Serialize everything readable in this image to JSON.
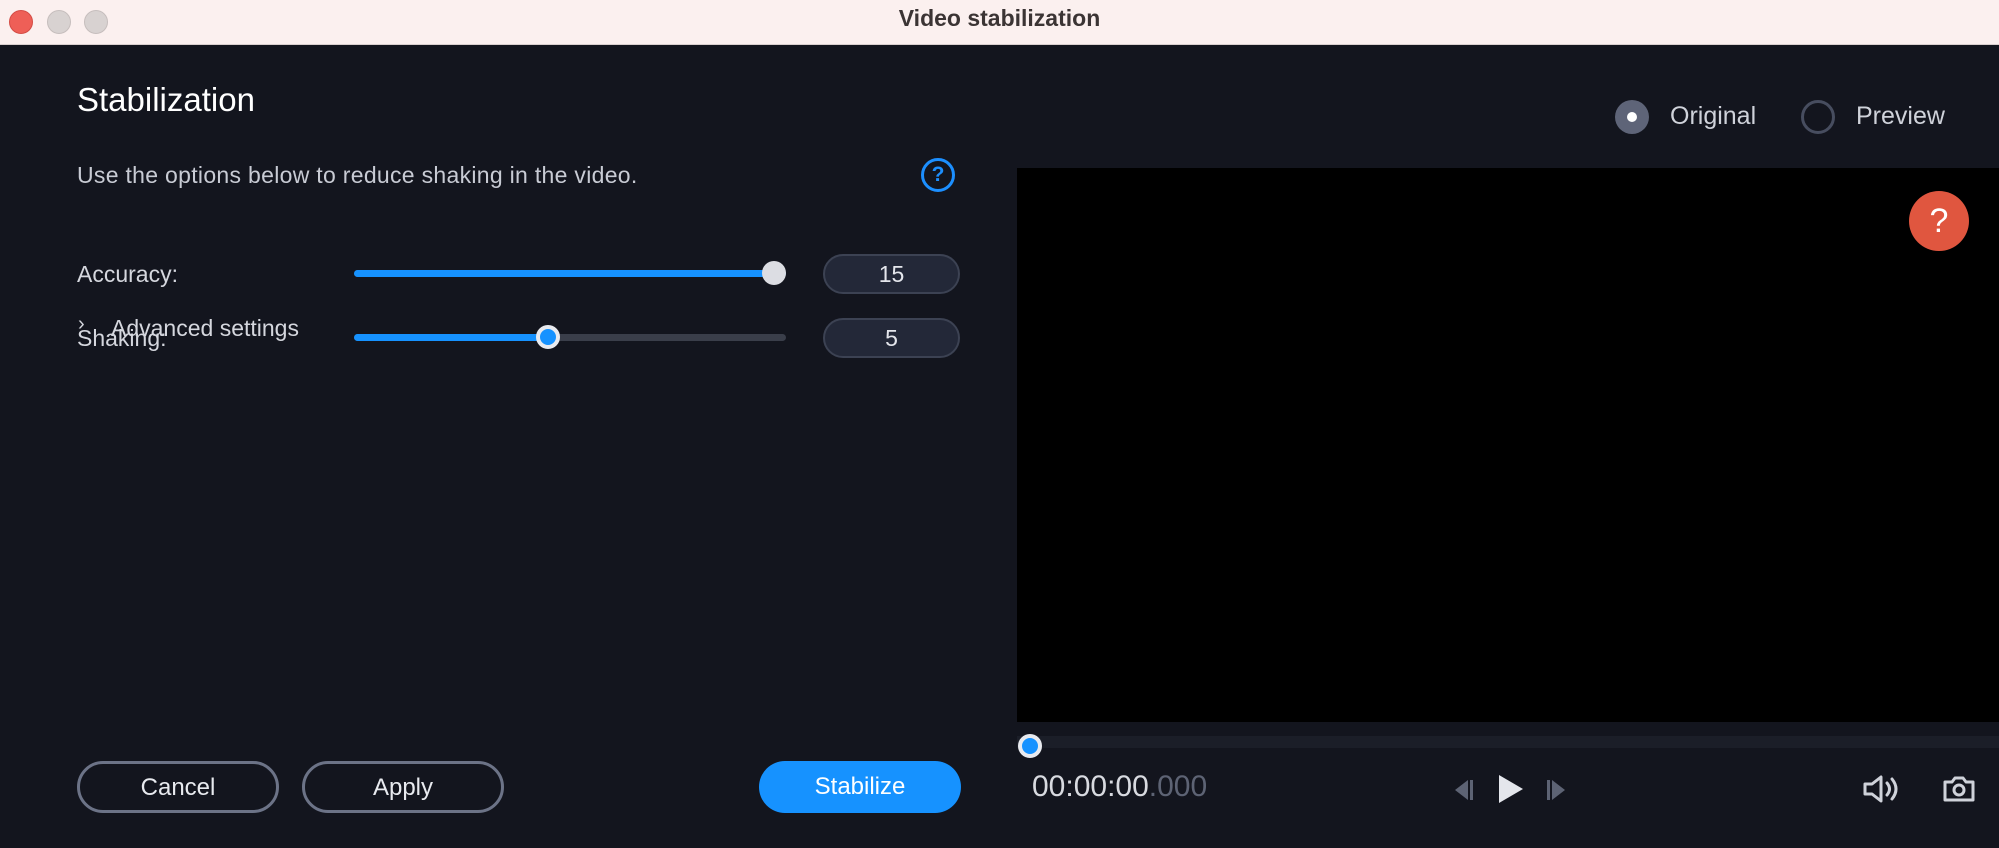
{
  "window": {
    "title": "Video stabilization"
  },
  "panel": {
    "heading": "Stabilization",
    "description": "Use the options below to reduce shaking in the video.",
    "help_glyph": "?",
    "accuracy": {
      "label": "Accuracy:",
      "value": "15",
      "level": 1.0
    },
    "shaking": {
      "label": "Shaking:",
      "value": "5",
      "level": 0.45
    },
    "advanced": {
      "chevron": "›",
      "label": "Advanced settings"
    }
  },
  "buttons": {
    "cancel": "Cancel",
    "apply": "Apply",
    "stabilize": "Stabilize"
  },
  "view_mode": {
    "original": "Original",
    "preview": "Preview",
    "selected": "Original"
  },
  "player": {
    "help_glyph": "?",
    "timecode_main": "00:00:00",
    "timecode_ms": ".000",
    "position": 0.0
  },
  "icons": [
    "help-circle-icon",
    "chevron-right-icon",
    "previous-frame-icon",
    "play-icon",
    "next-frame-icon",
    "volume-icon",
    "camera-icon"
  ],
  "colors": {
    "accent": "#1692ff",
    "help_bubble": "#e0563f",
    "background": "#13151e"
  }
}
